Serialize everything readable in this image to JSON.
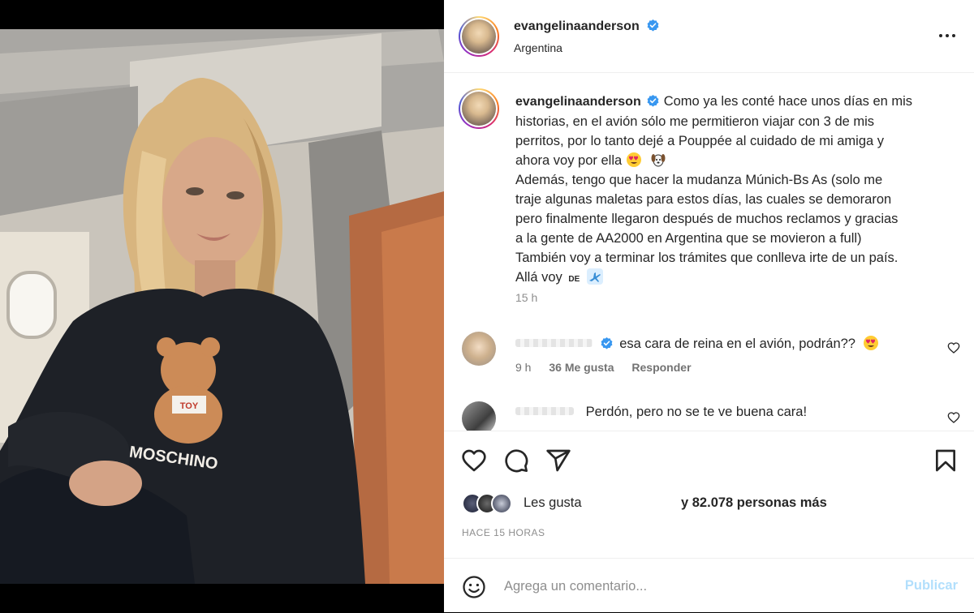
{
  "post": {
    "username": "evangelinaanderson",
    "location": "Argentina",
    "caption_lines": [
      "Como ya les conté hace unos días en mis",
      "historias, en el avión sólo me permitieron viajar con 3 de mis",
      "perritos, por lo tanto dejé a Pouppée al cuidado de mi amiga y",
      "ahora voy por ella",
      "Además, tengo que hacer la mudanza Múnich-Bs As (solo me",
      "traje algunas maletas para estos días, las cuales se demoraron",
      "pero finalmente llegaron después de muchos reclamos y gracias",
      "a la gente de AA2000 en Argentina que se movieron a full)",
      "También voy a terminar los trámites que conlleva irte de un país.",
      "Allá voy"
    ],
    "caption_suffix_tag": "DE",
    "caption_time": "15 h"
  },
  "comments": [
    {
      "text": "esa cara de reina en el avión, podrán??",
      "time": "9 h",
      "likes": "36 Me gusta",
      "reply": "Responder"
    },
    {
      "text": "Perdón, pero no se te ve buena cara!"
    }
  ],
  "likes": {
    "prefix": "Les gusta",
    "suffix": "y 82.078 personas más"
  },
  "timestamp": "HACE 15 HORAS",
  "add_comment": {
    "placeholder": "Agrega un comentario...",
    "publish": "Publicar"
  },
  "colors": {
    "verified": "#3897f0",
    "publish_disabled": "#b2dffc",
    "muted": "#8e8e8e"
  },
  "icons": [
    "more-icon",
    "heart-icon",
    "comment-icon",
    "share-icon",
    "bookmark-icon",
    "emoji-icon",
    "verified-badge-icon",
    "airplane-icon"
  ]
}
